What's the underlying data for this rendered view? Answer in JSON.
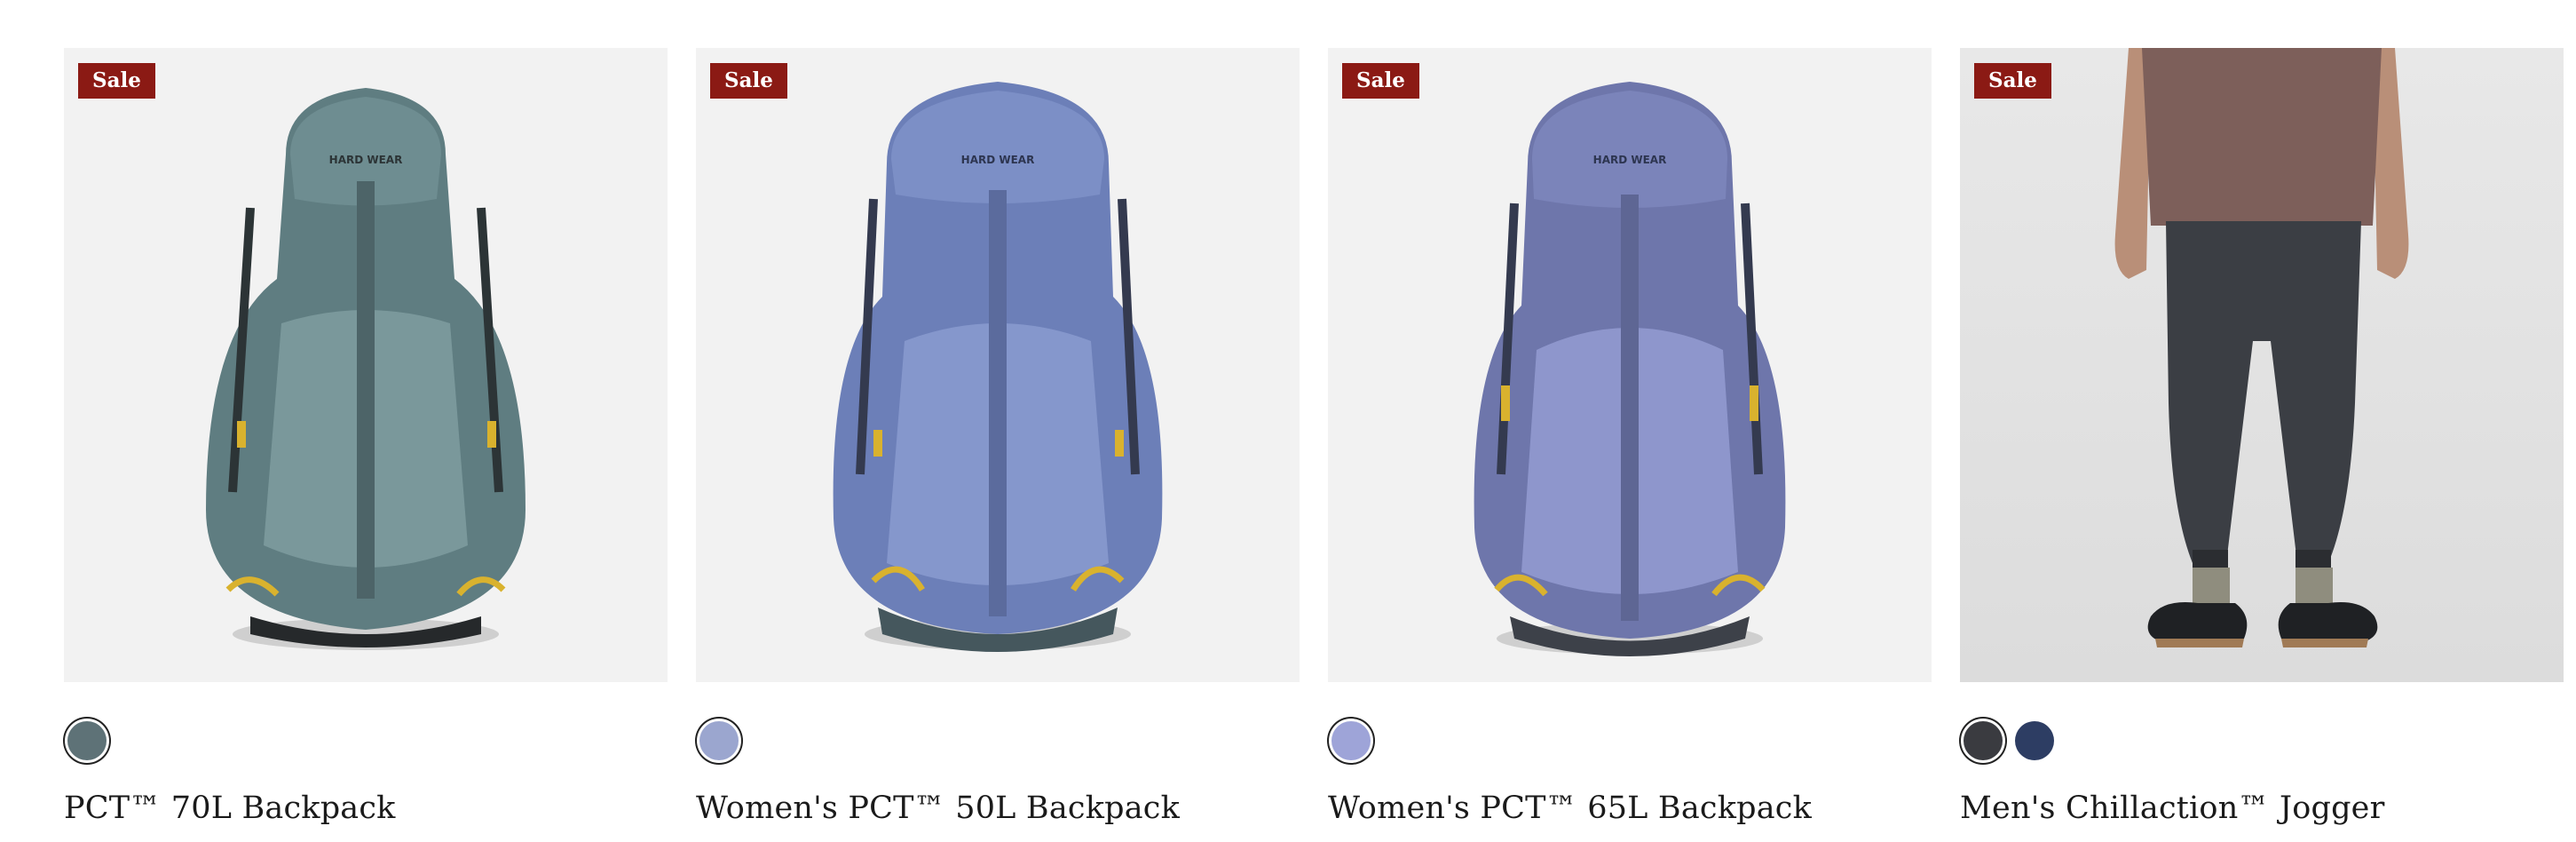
{
  "products": [
    {
      "badge": "Sale",
      "title": "PCT™ 70L Backpack",
      "image_icon": "backpack-image",
      "swatches": [
        {
          "color": "#5e7277",
          "selected": true
        }
      ]
    },
    {
      "badge": "Sale",
      "title": "Women's PCT™ 50L Backpack",
      "image_icon": "backpack-image",
      "swatches": [
        {
          "color": "#9ba6cf",
          "selected": true
        }
      ]
    },
    {
      "badge": "Sale",
      "title": "Women's PCT™ 65L Backpack",
      "image_icon": "backpack-image",
      "swatches": [
        {
          "color": "#9ea4d8",
          "selected": true
        }
      ]
    },
    {
      "badge": "Sale",
      "title": "Men's Chillaction™ Jogger",
      "image_icon": "jogger-model-image",
      "swatches": [
        {
          "color": "#3a3b40",
          "selected": true
        },
        {
          "color": "#2d3d63",
          "selected": false
        }
      ]
    }
  ],
  "colors": {
    "sale_badge": "#8b1a14",
    "image_background": "#f2f2f2",
    "title_text": "#1a1a1a"
  }
}
